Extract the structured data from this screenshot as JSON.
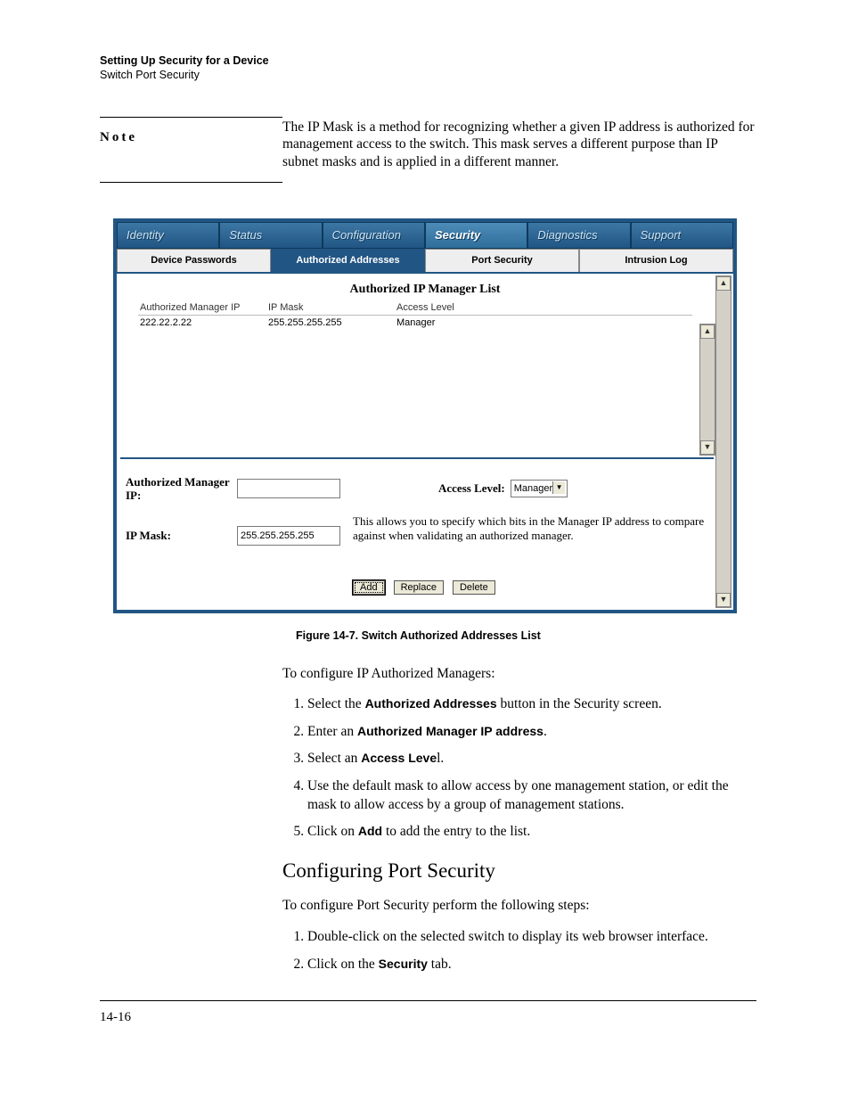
{
  "running_head": {
    "bold": "Setting Up Security for a Device",
    "plain": "Switch Port Security"
  },
  "note": {
    "label": "Note",
    "body": "The IP Mask is a method for recognizing whether a given IP address is authorized for management access to the switch. This mask serves a different purpose than IP subnet masks and is applied in a different manner."
  },
  "figure": {
    "top_tabs": {
      "identity": "Identity",
      "status": "Status",
      "configuration": "Configuration",
      "security": "Security",
      "diagnostics": "Diagnostics",
      "support": "Support"
    },
    "sub_tabs": {
      "device_passwords": "Device Passwords",
      "authorized_addresses": "Authorized Addresses",
      "port_security": "Port Security",
      "intrusion_log": "Intrusion Log"
    },
    "list_title": "Authorized IP Manager List",
    "columns": {
      "ip": "Authorized Manager IP",
      "mask": "IP Mask",
      "access": "Access Level"
    },
    "rows": [
      {
        "ip": "222.22.2.22",
        "mask": "255.255.255.255",
        "access": "Manager"
      }
    ],
    "form": {
      "auth_ip_label": "Authorized Manager IP:",
      "auth_ip_value": "",
      "access_level_label": "Access Level:",
      "access_level_value": "Manager",
      "ip_mask_label": "IP Mask:",
      "ip_mask_value": "255.255.255.255",
      "help": "This allows you to specify which bits in the Manager IP address to compare against when validating an authorized manager.",
      "buttons": {
        "add": "Add",
        "replace": "Replace",
        "delete": "Delete"
      }
    }
  },
  "caption": "Figure 14-7.  Switch Authorized Addresses List",
  "body": {
    "intro1": "To configure IP Authorized Managers:",
    "steps1": [
      {
        "pre": "Select the ",
        "b": "Authorized Addresses",
        "post": " button in the Security screen."
      },
      {
        "pre": "Enter an ",
        "b": "Authorized Manager IP address",
        "post": "."
      },
      {
        "pre": "Select an ",
        "b": "Access Leve",
        "post": "l."
      },
      {
        "pre": "Use the default mask to allow access by one management station, or edit the mask to allow access by a group of management stations.",
        "b": "",
        "post": ""
      },
      {
        "pre": "Click on ",
        "b": "Add",
        "post": " to add the entry to the list."
      }
    ],
    "h2": "Configuring Port Security",
    "intro2": "To configure Port Security perform the following steps:",
    "steps2": [
      {
        "pre": "Double-click on the selected switch to display its web browser interface.",
        "b": "",
        "post": ""
      },
      {
        "pre": "Click on the ",
        "b": "Security",
        "post": " tab."
      }
    ]
  },
  "page_number": "14-16"
}
